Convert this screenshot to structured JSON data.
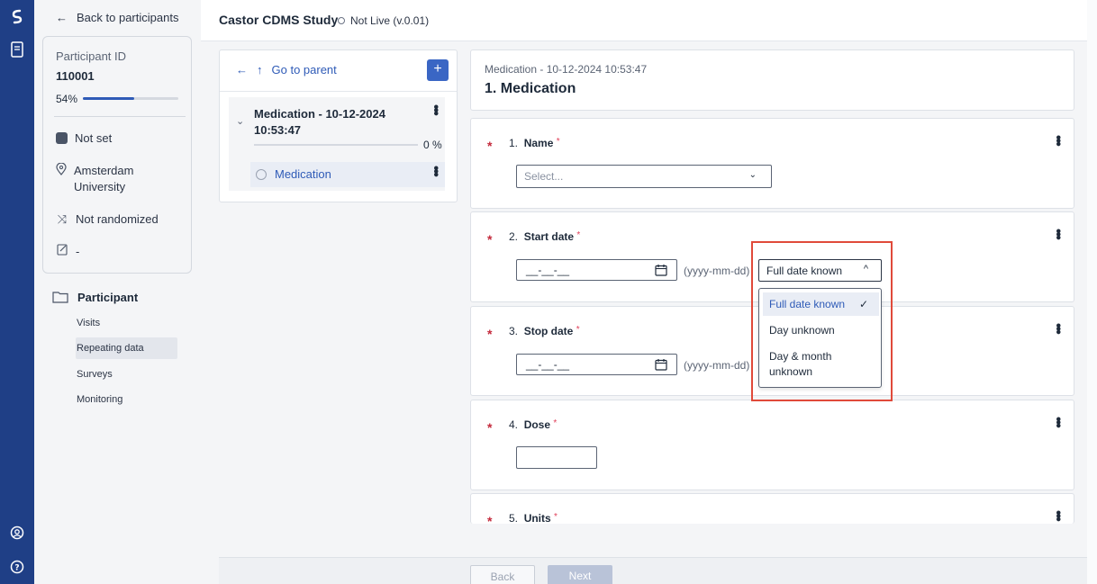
{
  "sidebar": {
    "back_label": "Back to participants",
    "participant_id_label": "Participant ID",
    "participant_id": "110001",
    "progress_text": "54%",
    "progress": 0.54,
    "status": "Not set",
    "site": "Amsterdam University",
    "randomization": "Not randomized",
    "note": "-",
    "nav_heading": "Participant",
    "nav_items": [
      "Visits",
      "Repeating data",
      "Surveys",
      "Monitoring"
    ],
    "active_item": "Repeating data"
  },
  "header": {
    "study_title": "Castor CDMS Study",
    "study_status": "Not Live (v.0.01)"
  },
  "tree": {
    "go_to_parent": "Go to parent",
    "add_label": "+",
    "node_title": "Medication - 10-12-2024 10:53:47",
    "node_progress": "0 %",
    "child_label": "Medication"
  },
  "form": {
    "subtitle": "Medication - 10-12-2024 10:53:47",
    "title": "1. Medication",
    "fields": [
      {
        "number": "1.",
        "label": "Name",
        "placeholder": "Select..."
      },
      {
        "number": "2.",
        "label": "Start date",
        "value": "__-__-__",
        "format": "(yyyy-mm-dd)",
        "known": "Full date known"
      },
      {
        "number": "3.",
        "label": "Stop date",
        "value": "__-__-__",
        "format": "(yyyy-mm-dd)"
      },
      {
        "number": "4.",
        "label": "Dose"
      },
      {
        "number": "5.",
        "label": "Units"
      }
    ],
    "required_mark": "*"
  },
  "dropdown": {
    "options": [
      "Full date known",
      "Day unknown",
      "Day & month unknown"
    ],
    "selected": "Full date known",
    "accent": "#2f5bb7",
    "highlight_color": "#e04a3a"
  },
  "footer": {
    "back_label": "Back",
    "next_label": "Next"
  },
  "colors": {
    "rail": "#1f3f86",
    "primary": "#3a66c4",
    "required": "#c42a3c"
  }
}
